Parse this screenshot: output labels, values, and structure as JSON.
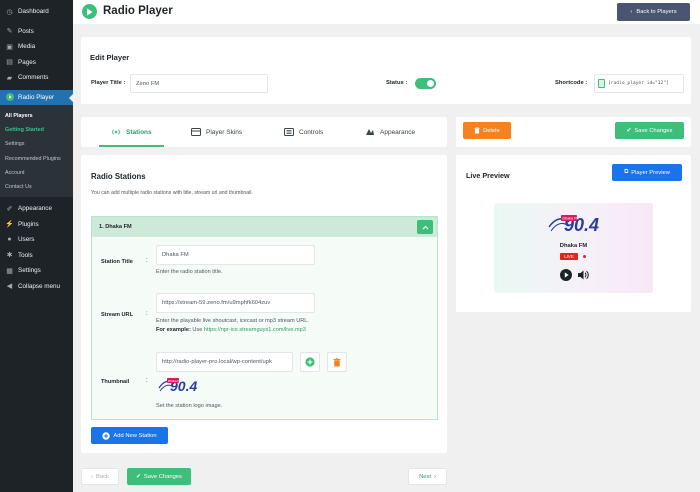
{
  "sidebar": {
    "items_top": [
      {
        "label": "Dashboard",
        "icon": "dashboard-icon"
      },
      {
        "label": "Posts",
        "icon": "pin-icon"
      },
      {
        "label": "Media",
        "icon": "media-icon"
      },
      {
        "label": "Pages",
        "icon": "pages-icon"
      },
      {
        "label": "Comments",
        "icon": "comments-icon"
      }
    ],
    "active": {
      "label": "Radio Player",
      "icon": "radio-player-icon"
    },
    "submenu": [
      "All Players",
      "Getting Started",
      "Settings",
      "Recommended Plugins",
      "Account",
      "Contact Us"
    ],
    "items_bottom": [
      {
        "label": "Appearance",
        "icon": "brush-icon"
      },
      {
        "label": "Plugins",
        "icon": "plugin-icon"
      },
      {
        "label": "Users",
        "icon": "users-icon"
      },
      {
        "label": "Tools",
        "icon": "wrench-icon"
      },
      {
        "label": "Settings",
        "icon": "settings-icon"
      },
      {
        "label": "Collapse menu",
        "icon": "collapse-icon"
      }
    ]
  },
  "header": {
    "title": "Radio Player",
    "back_label": "Back to Players"
  },
  "edit": {
    "title": "Edit Player",
    "player_title_label": "Player Title :",
    "player_title_value": "Zeno FM",
    "status_label": "Status :",
    "status_on": true,
    "shortcode_label": "Shortcode :",
    "shortcode_value": "[radio_player id=\"12\"]"
  },
  "tabs": [
    {
      "label": "Stations",
      "icon": "radio-waves-icon",
      "active": true
    },
    {
      "label": "Player Skins",
      "icon": "player-skins-icon",
      "active": false
    },
    {
      "label": "Controls",
      "icon": "controls-icon",
      "active": false
    },
    {
      "label": "Appearance",
      "icon": "appearance-icon",
      "active": false
    }
  ],
  "stations": {
    "title": "Radio Stations",
    "description": "You can add multiple radio stations with title, stream url and thumbnail.",
    "station_header": "1. Dhaka FM",
    "title_label": "Station Title",
    "title_value": "Dhaka FM",
    "title_help": "Enter the radio station title.",
    "url_label": "Stream URL",
    "url_value": "https://stream-59.zeno.fm/u9mphfk604zuv",
    "url_help": "Enter the playable live shoutcast, icecast or mp3 stream URL.",
    "url_example_label": "For example:",
    "url_example_use": "Use",
    "url_example_link": "https://npr-ice.streamguys1.com/live.mp3",
    "thumb_label": "Thumbnail",
    "thumb_value": "http://radio-player-pro.local/wp-content/upk",
    "thumb_help": "Set the station logo image.",
    "colon": ":",
    "add_label": "Add New Station"
  },
  "nav": {
    "back_label": "Back",
    "save_label": "Save Changes",
    "next_label": "Next"
  },
  "actions": {
    "delete_label": "Delete",
    "save_label": "Save Changes"
  },
  "preview": {
    "title": "Live Preview",
    "button_label": "Player Preview",
    "station_name": "Dhaka FM",
    "live_label": "LIVE",
    "logo_number": "90.4",
    "logo_badge": "Dhaka FM"
  },
  "colors": {
    "accent": "#3dbe7b",
    "blue": "#1a73e8",
    "orange": "#f58220",
    "sidebar": "#1d2327",
    "wp_blue": "#2271b1"
  }
}
